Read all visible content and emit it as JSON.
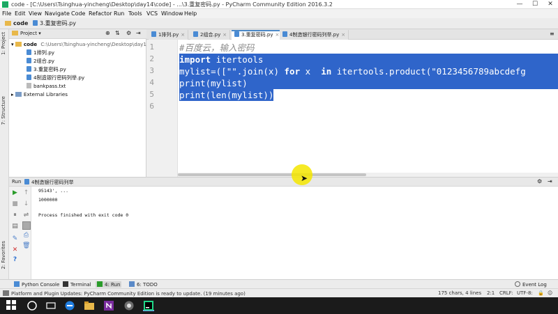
{
  "window": {
    "title": "code - [C:\\Users\\Tsinghua-yincheng\\Desktop\\day14\\code] - ...\\3.重复密码.py - PyCharm Community Edition 2016.3.2",
    "controls": {
      "minimize": "—",
      "maximize": "☐",
      "close": "✕"
    }
  },
  "menu": [
    "File",
    "Edit",
    "View",
    "Navigate",
    "Code",
    "Refactor",
    "Run",
    "Tools",
    "VCS",
    "Window",
    "Help"
  ],
  "nav": {
    "crumb_project": "code",
    "crumb_file": "3.重复密码.py"
  },
  "side_tabs": {
    "project": "1: Project",
    "structure": "7: Structure",
    "favorites": "2: Favorites"
  },
  "project_panel": {
    "header": "Project",
    "root_name": "code",
    "root_path": "C:\\Users\\Tsinghua-yincheng\\Desktop\\day14",
    "files": [
      "1排列.py",
      "2组合.py",
      "3.重复密码.py",
      "4制造银行密码列举.py",
      "bankpass.txt"
    ],
    "external": "External Libraries"
  },
  "editor_tabs": [
    {
      "label": "1排列.py",
      "active": false
    },
    {
      "label": "2组合.py",
      "active": false
    },
    {
      "label": "3.重复密码.py",
      "active": true
    },
    {
      "label": "4制造银行密码列举.py",
      "active": false
    }
  ],
  "code": {
    "line_numbers": [
      "1",
      "2",
      "3",
      "4",
      "5",
      "6"
    ],
    "comment": "#百度云，输入密码",
    "line2_kw": "import",
    "line2_rest": " itertools",
    "line3_a": "mylist=([\"\".join(x) ",
    "line3_kw1": "for",
    "line3_b": " x  ",
    "line3_kw2": "in",
    "line3_c": " itertools.product(\"0123456789abcdefg",
    "line4": "print(mylist)",
    "line5": "print(len(mylist))"
  },
  "run_panel": {
    "label": "Run",
    "config": "4制造银行密码列举",
    "output": [
      "95143', ...",
      "1000000",
      "",
      "Process finished with exit code 0"
    ]
  },
  "bottom_tabs": [
    "Python Console",
    "Terminal",
    "4: Run",
    "6: TODO"
  ],
  "event_log": "Event Log",
  "status": {
    "message": "Platform and Plugin Updates: PyCharm Community Edition is ready to update. (19 minutes ago)",
    "chars": "175 chars, 4 lines",
    "pos": "2:1",
    "line_sep": "CRLF:",
    "encoding": "UTF-8:"
  }
}
